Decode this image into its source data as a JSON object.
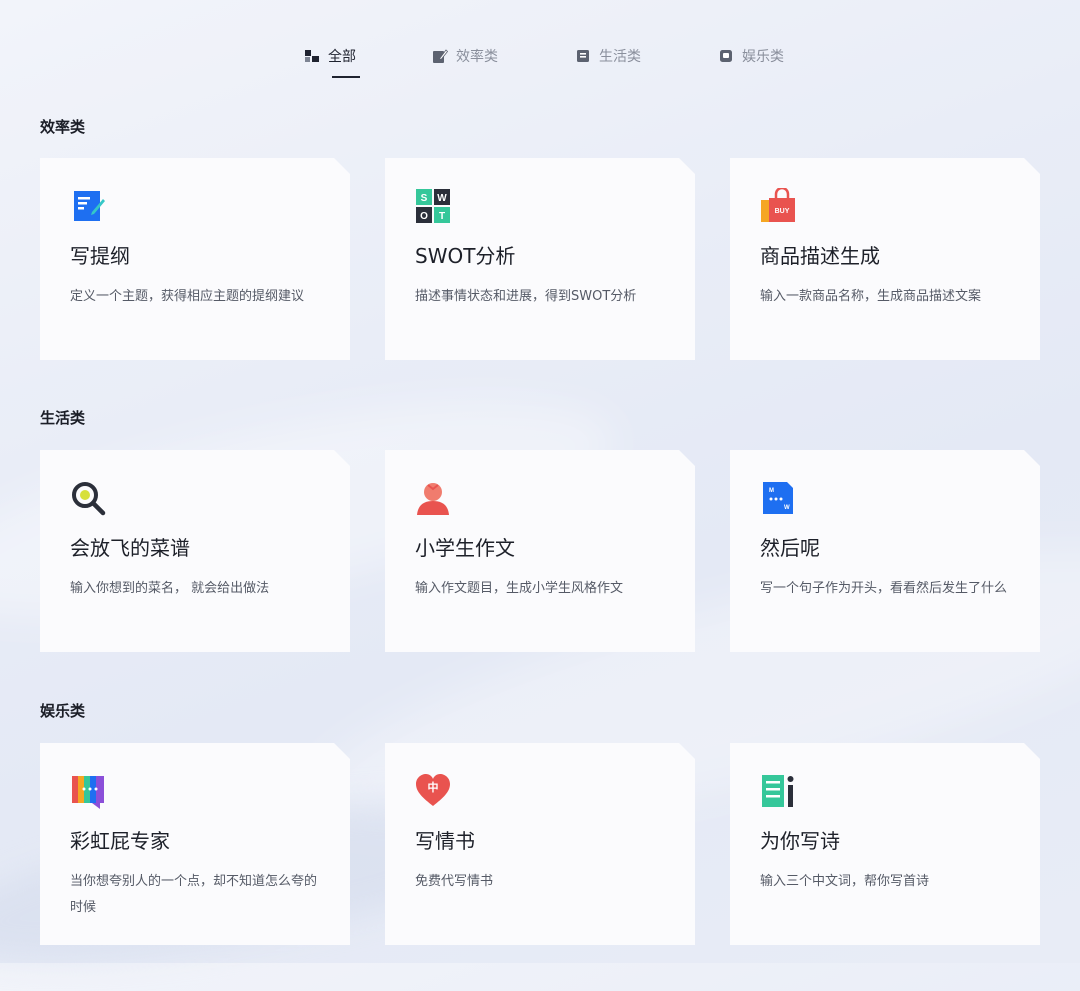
{
  "tabs": [
    {
      "label": "全部",
      "icon": "grid-icon",
      "active": true
    },
    {
      "label": "效率类",
      "icon": "edit-icon",
      "active": false
    },
    {
      "label": "生活类",
      "icon": "book-icon",
      "active": false
    },
    {
      "label": "娱乐类",
      "icon": "game-icon",
      "active": false
    }
  ],
  "sections": [
    {
      "title": "效率类",
      "cards": [
        {
          "title": "写提纲",
          "desc": "定义一个主题，获得相应主题的提纲建议",
          "icon": "outline-doc-icon"
        },
        {
          "title": "SWOT分析",
          "desc": "描述事情状态和进展，得到SWOT分析",
          "icon": "swot-grid-icon",
          "icon_letters": [
            "S",
            "W",
            "O",
            "T"
          ]
        },
        {
          "title": "商品描述生成",
          "desc": "输入一款商品名称，生成商品描述文案",
          "icon": "shopping-bag-icon",
          "icon_text": "BUY"
        }
      ]
    },
    {
      "title": "生活类",
      "cards": [
        {
          "title": "会放飞的菜谱",
          "desc": "输入你想到的菜名， 就会给出做法",
          "icon": "magnifier-icon"
        },
        {
          "title": "小学生作文",
          "desc": "输入作文题目，生成小学生风格作文",
          "icon": "student-icon"
        },
        {
          "title": "然后呢",
          "desc": "写一个句子作为开头，看看然后发生了什么",
          "icon": "dialog-doc-icon",
          "icon_letters": [
            "M",
            "W"
          ]
        }
      ]
    },
    {
      "title": "娱乐类",
      "cards": [
        {
          "title": "彩虹屁专家",
          "desc": "当你想夸别人的一个点，却不知道怎么夸的时候",
          "icon": "rainbow-chat-icon"
        },
        {
          "title": "写情书",
          "desc": "免费代写情书",
          "icon": "heart-icon",
          "icon_text": "中"
        },
        {
          "title": "为你写诗",
          "desc": "输入三个中文词，帮你写首诗",
          "icon": "poem-icon"
        }
      ]
    }
  ],
  "colors": {
    "accent": "#1f2330",
    "muted": "#8a8f9c",
    "card_bg": "#fbfbfd",
    "blue": "#1e6ff1",
    "green": "#35c79a",
    "red": "#e9534f",
    "orange": "#f5a623"
  }
}
